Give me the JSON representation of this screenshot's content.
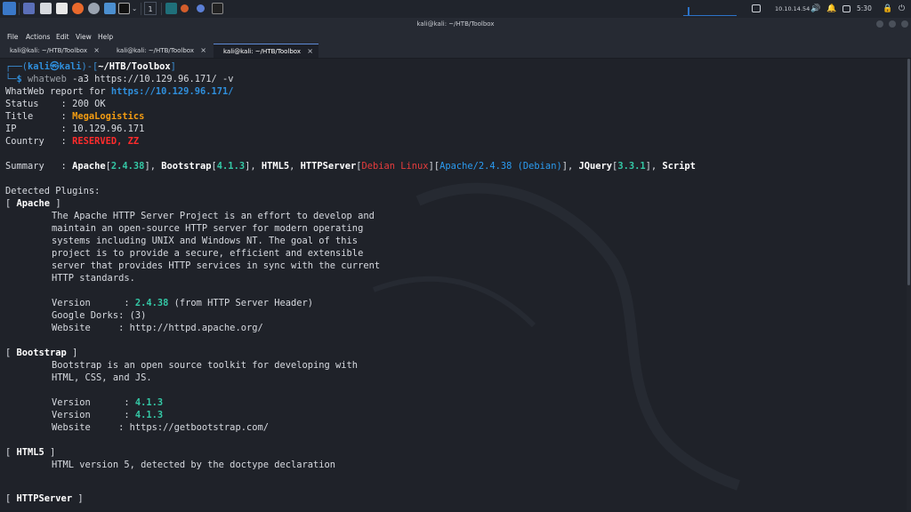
{
  "taskbar": {
    "workspace": "1",
    "ip": "10.10.14.54",
    "clock": "5:30"
  },
  "window": {
    "title": "kali@kali: ~/HTB/Toolbox"
  },
  "menu": {
    "file": "File",
    "actions": "Actions",
    "edit": "Edit",
    "view": "View",
    "help": "Help"
  },
  "tabs": [
    {
      "label": "kali@kali: ~/HTB/Toolbox",
      "close": "×"
    },
    {
      "label": "kali@kali: ~/HTB/Toolbox",
      "close": "×"
    },
    {
      "label": "kali@kali: ~/HTB/Toolbox",
      "close": "×"
    }
  ],
  "terminal": {
    "prompt": {
      "corner_top": "┌──(",
      "user": "kali",
      "at": "㉿",
      "host": "kali",
      "mid": ")-[",
      "path": "~/HTB/Toolbox",
      "end": "]",
      "corner_bottom": "└─",
      "dollar": "$ ",
      "cmd": "whatweb",
      "args": " -a3 https://10.129.96.171/ -v"
    },
    "report": {
      "label": "WhatWeb report for ",
      "url": "https://10.129.96.171/"
    },
    "status": {
      "label": "Status    : ",
      "value": "200 OK"
    },
    "title": {
      "label": "Title     : ",
      "value": "MegaLogistics"
    },
    "ip": {
      "label": "IP        : ",
      "value": "10.129.96.171"
    },
    "country": {
      "label": "Country   : ",
      "value": "RESERVED, ZZ"
    },
    "summary": {
      "label": "Summary   : ",
      "apache": "Apache",
      "apache_ver": "2.4.38",
      "bootstrap": "Bootstrap",
      "bootstrap_ver": "4.1.3",
      "html5": "HTML5",
      "httpserver": "HTTPServer",
      "os": "Debian Linux",
      "server": "Apache/2.4.38 (Debian)",
      "jquery": "JQuery",
      "jquery_ver": "3.3.1",
      "script": "Script"
    },
    "detected": "Detected Plugins:",
    "apache": {
      "name": "Apache",
      "desc": [
        "The Apache HTTP Server Project is an effort to develop and",
        "maintain an open-source HTTP server for modern operating",
        "systems including UNIX and Windows NT. The goal of this",
        "project is to provide a secure, efficient and extensible",
        "server that provides HTTP services in sync with the current",
        "HTTP standards."
      ],
      "version_label": "Version      : ",
      "version": "2.4.38",
      "version_note": " (from HTTP Server Header)",
      "dorks": "Google Dorks: (3)",
      "website": "Website     : http://httpd.apache.org/"
    },
    "bootstrap": {
      "name": "Bootstrap",
      "desc": [
        "Bootstrap is an open source toolkit for developing with",
        "HTML, CSS, and JS."
      ],
      "version_label": "Version      : ",
      "version1": "4.1.3",
      "version2": "4.1.3",
      "website": "Website     : https://getbootstrap.com/"
    },
    "html5": {
      "name": "HTML5",
      "desc": "HTML version 5, detected by the doctype declaration"
    },
    "httpserver": {
      "name": "HTTPServer"
    },
    "bracket_open": "[ ",
    "bracket_close": " ]"
  }
}
